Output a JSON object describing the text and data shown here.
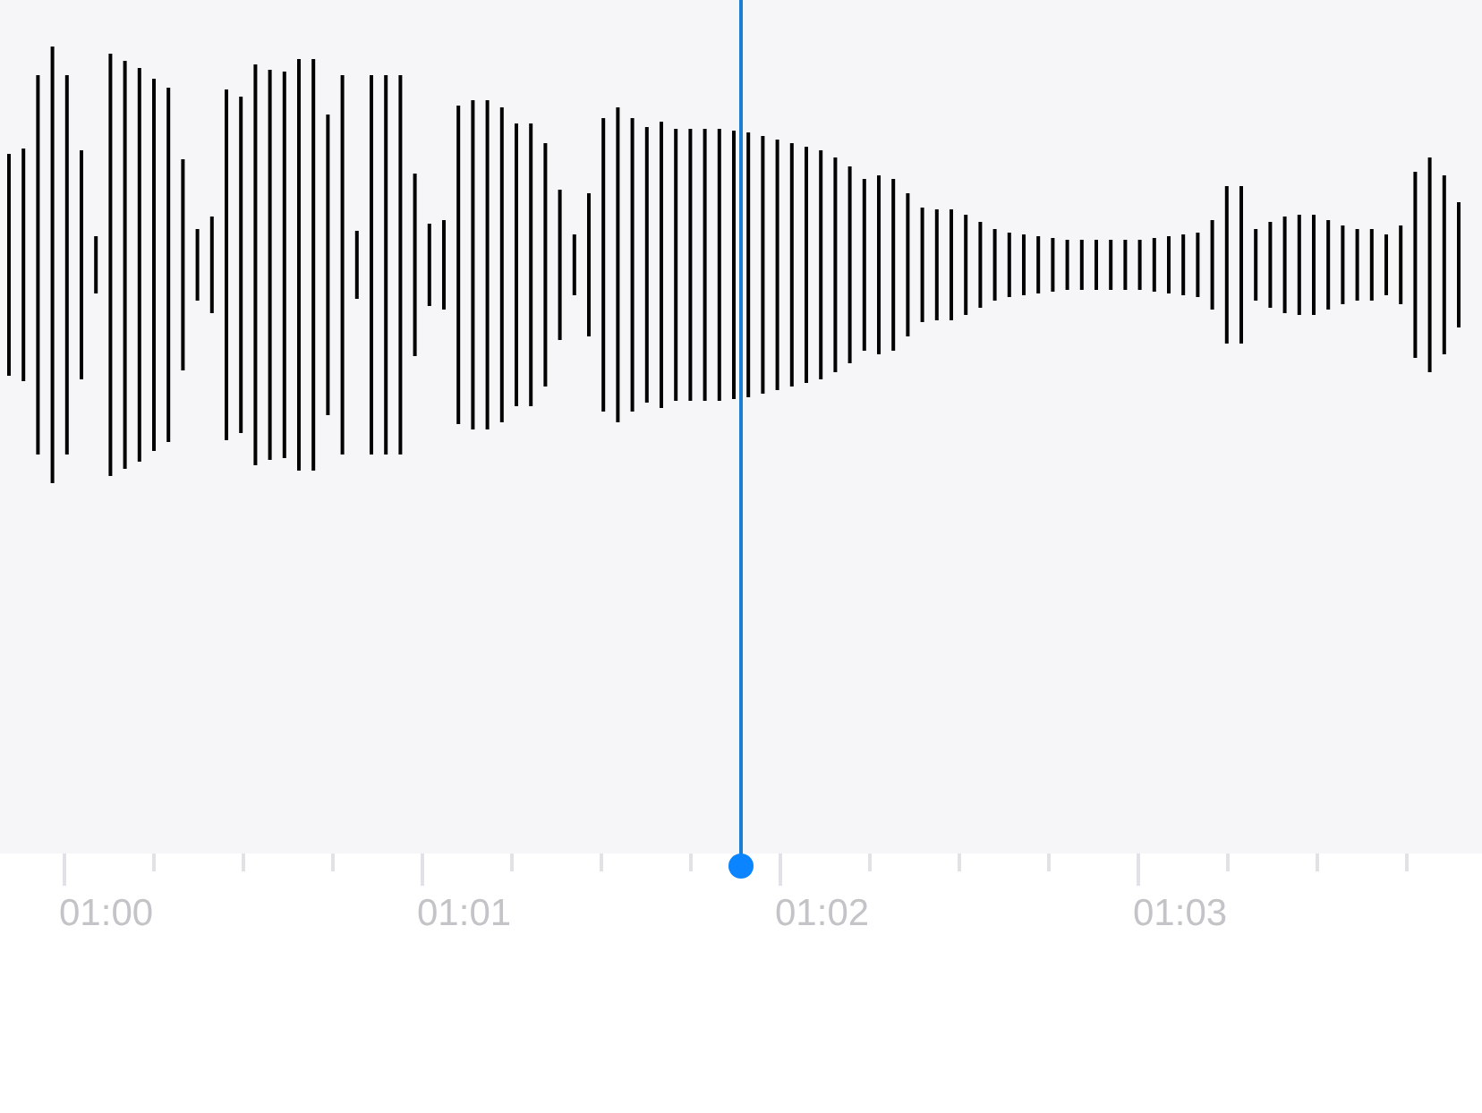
{
  "timeline": {
    "labels": [
      "01:00",
      "01:01",
      "01:02",
      "01:03"
    ]
  }
}
